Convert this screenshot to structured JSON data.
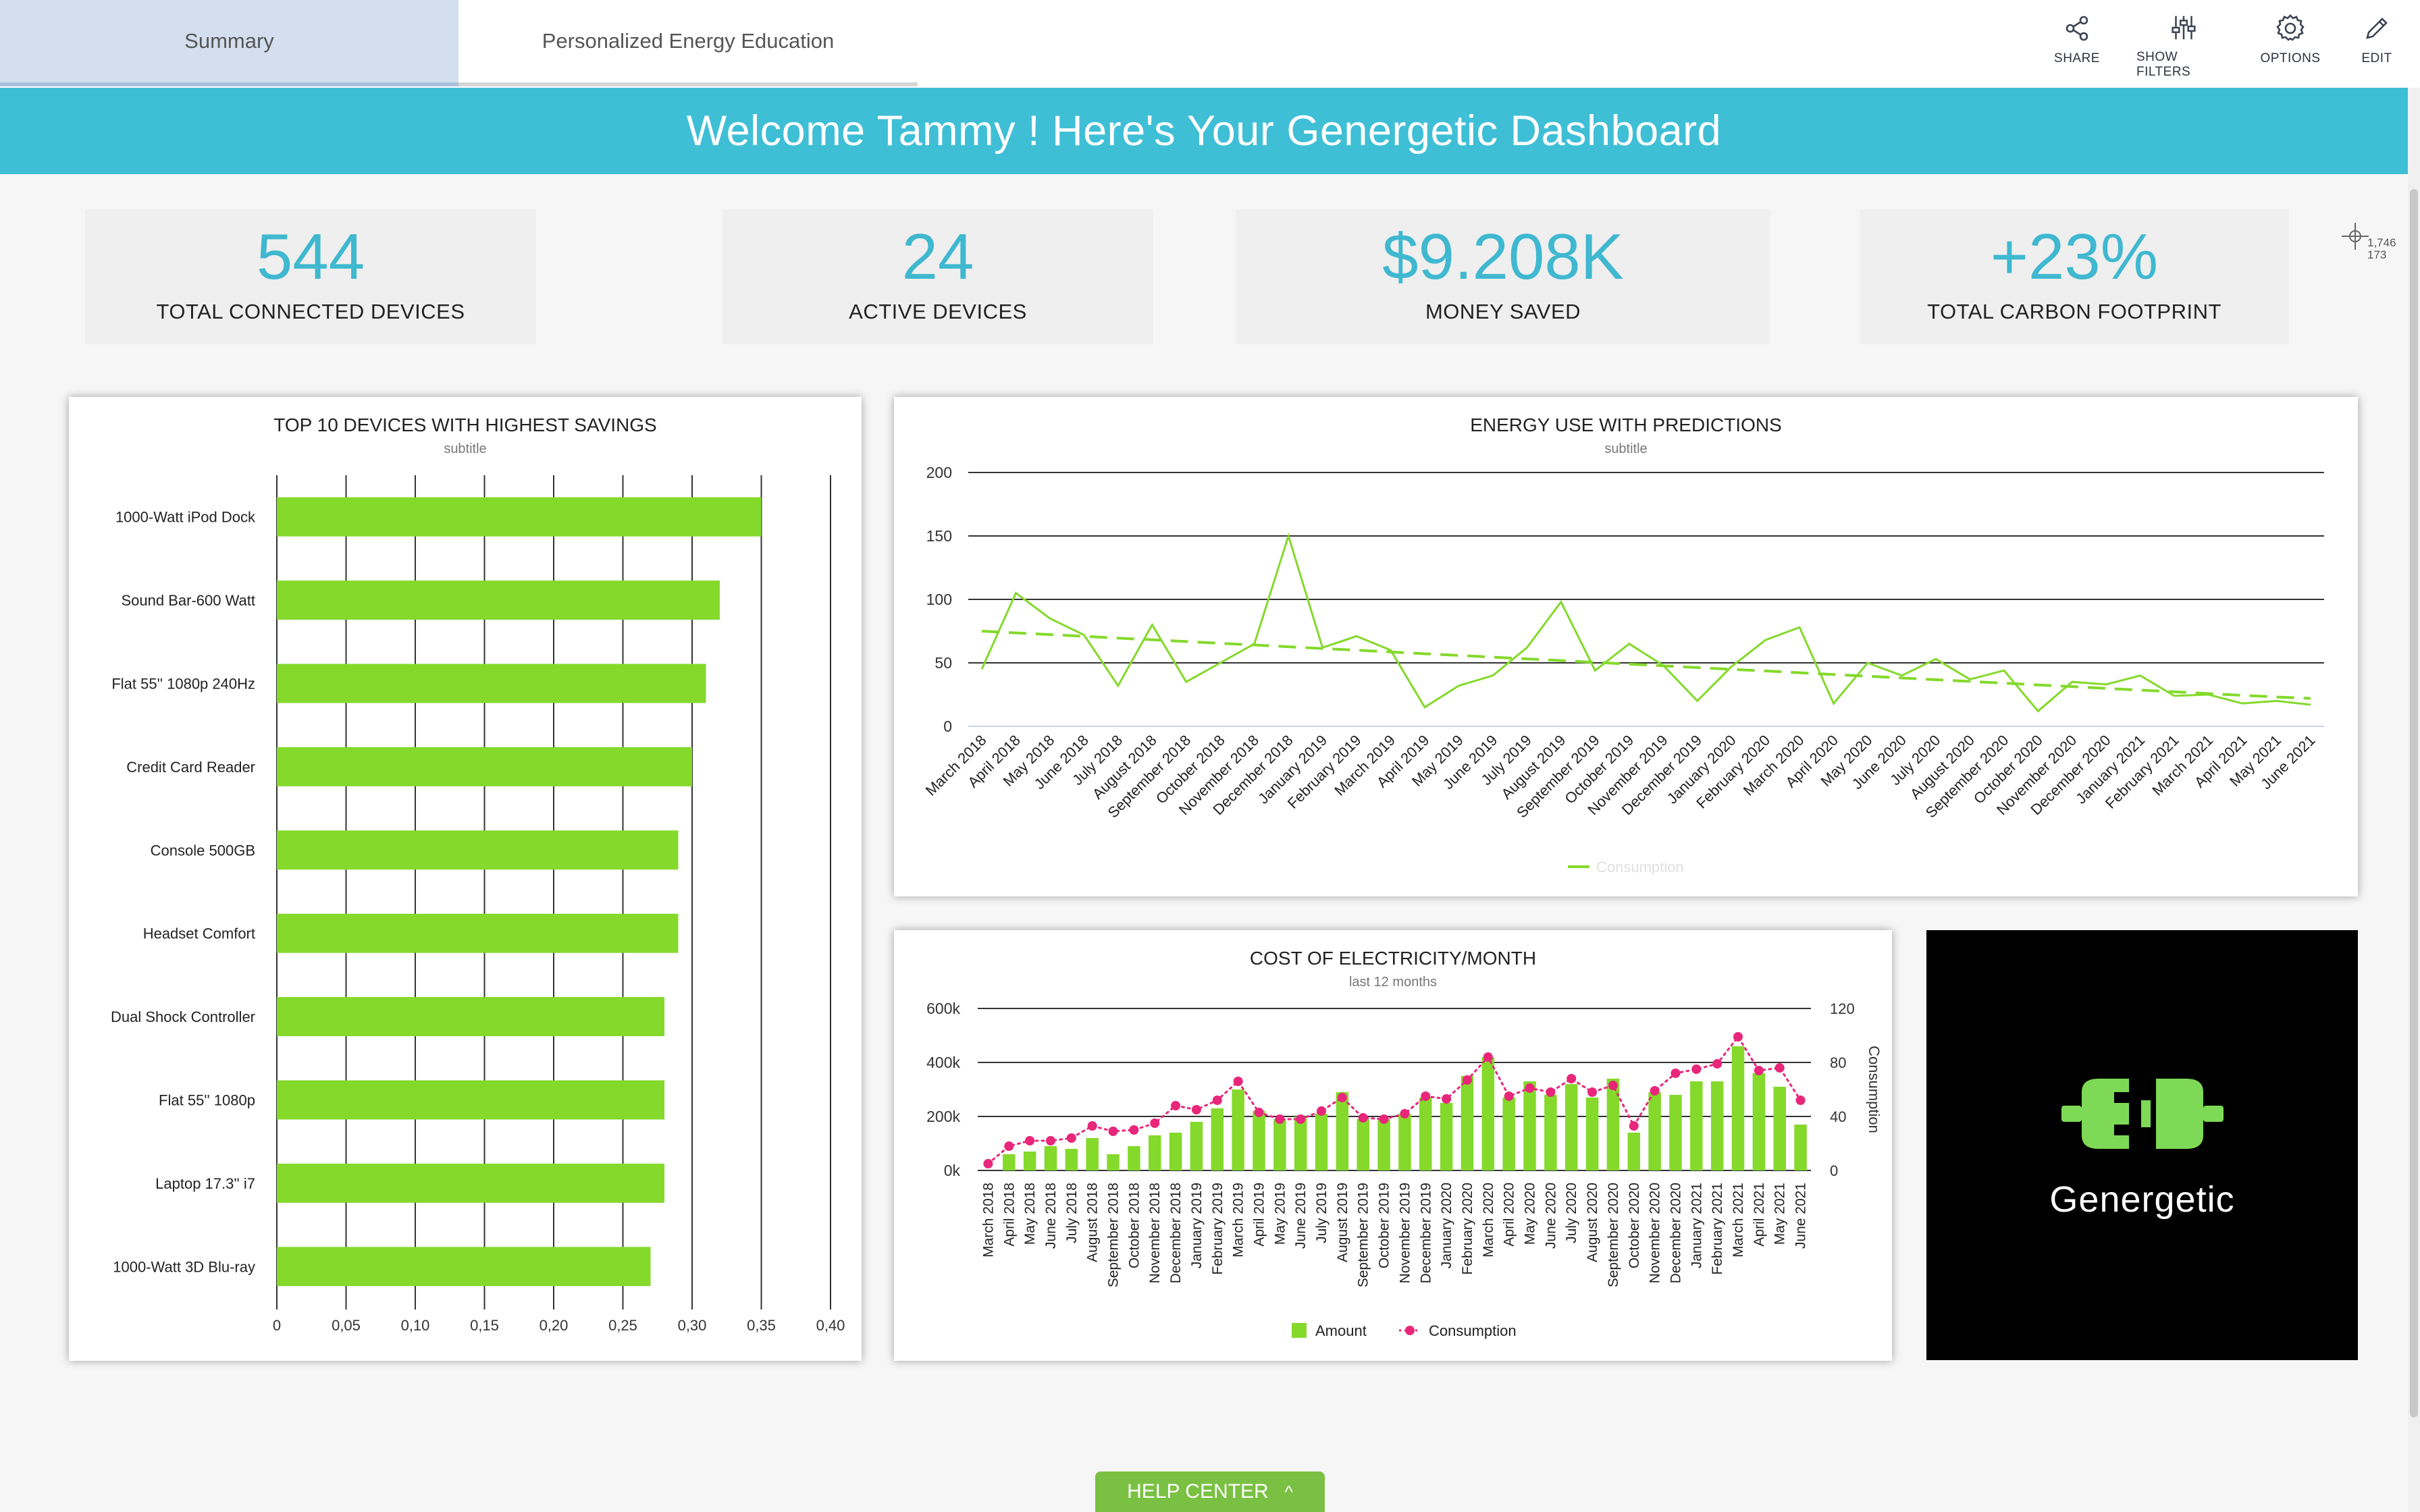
{
  "tabs": [
    {
      "label": "Summary"
    },
    {
      "label": "Personalized Energy Education"
    }
  ],
  "toolbar": {
    "share": "SHARE",
    "show_filters": "SHOW FILTERS",
    "options": "OPTIONS",
    "edit": "EDIT"
  },
  "banner": {
    "text": "Welcome Tammy ! Here's Your Genergetic Dashboard"
  },
  "kpis": [
    {
      "value": "544",
      "label": "TOTAL CONNECTED DEVICES"
    },
    {
      "value": "24",
      "label": "ACTIVE DEVICES"
    },
    {
      "value": "$9.208K",
      "label": "MONEY SAVED"
    },
    {
      "value": "+23%",
      "label": "TOTAL CARBON FOOTPRINT"
    }
  ],
  "cursor_readout": {
    "line1": "1,746",
    "line2": "173"
  },
  "logo": {
    "text": "Genergetic"
  },
  "help_center": {
    "label": "HELP CENTER",
    "chevron": "^"
  },
  "colors": {
    "accent": "#3fbfd6",
    "green": "#7ed321",
    "pink": "#e8267a",
    "logo_green": "#7ed957"
  },
  "chart_data": [
    {
      "type": "bar",
      "orientation": "horizontal",
      "title": "TOP 10 DEVICES WITH HIGHEST SAVINGS",
      "subtitle": "subtitle",
      "categories": [
        "1000-Watt iPod Dock",
        "Sound Bar-600 Watt",
        "Flat 55'' 1080p 240Hz",
        "Credit Card Reader",
        "Console 500GB",
        "Headset Comfort",
        "Dual Shock Controller",
        "Flat 55'' 1080p",
        "Laptop 17.3'' i7",
        "1000-Watt 3D Blu-ray"
      ],
      "values": [
        0.35,
        0.32,
        0.31,
        0.3,
        0.29,
        0.29,
        0.28,
        0.28,
        0.28,
        0.27
      ],
      "xlim": [
        0,
        0.4
      ],
      "xticks": [
        "0",
        "0,05",
        "0,10",
        "0,15",
        "0,20",
        "0,25",
        "0,30",
        "0,35",
        "0,40"
      ],
      "color": "#84d92b",
      "grid": true
    },
    {
      "type": "line",
      "title": "ENERGY USE WITH PREDICTIONS",
      "subtitle": "subtitle",
      "categories": [
        "March 2018",
        "April 2018",
        "May 2018",
        "June 2018",
        "July 2018",
        "August 2018",
        "September 2018",
        "October 2018",
        "November 2018",
        "December 2018",
        "January 2019",
        "February 2019",
        "March 2019",
        "April 2019",
        "May 2019",
        "June 2019",
        "July 2019",
        "August 2019",
        "September 2019",
        "October 2019",
        "November 2019",
        "December 2019",
        "January 2020",
        "February 2020",
        "March 2020",
        "April 2020",
        "May 2020",
        "June 2020",
        "July 2020",
        "August 2020",
        "September 2020",
        "October 2020",
        "November 2020",
        "December 2020",
        "January 2021",
        "February 2021",
        "March 2021",
        "April 2021",
        "May 2021",
        "June 2021"
      ],
      "series": [
        {
          "name": "Consumption",
          "values": [
            45,
            105,
            85,
            72,
            32,
            80,
            35,
            50,
            65,
            150,
            62,
            71,
            60,
            15,
            32,
            40,
            62,
            98,
            44,
            65,
            48,
            20,
            47,
            68,
            78,
            18,
            50,
            40,
            53,
            37,
            44,
            12,
            35,
            33,
            40,
            24,
            25,
            18,
            20,
            17
          ],
          "style": "solid"
        },
        {
          "name": "",
          "values": [
            75,
            73.6,
            72.3,
            70.9,
            69.5,
            68.2,
            66.8,
            65.4,
            64.1,
            62.7,
            61.3,
            60.0,
            58.6,
            57.2,
            55.9,
            54.5,
            53.1,
            51.8,
            50.4,
            49.0,
            47.7,
            46.3,
            44.9,
            43.6,
            42.2,
            40.8,
            39.5,
            38.1,
            36.7,
            35.4,
            34.0,
            32.6,
            31.3,
            29.9,
            28.5,
            27.2,
            25.8,
            24.4,
            23.1,
            22
          ],
          "style": "dashed"
        }
      ],
      "yticks": [
        "0",
        "50",
        "100",
        "150",
        "200"
      ],
      "ylim": [
        0,
        200
      ],
      "legend": "bottom-center",
      "color": "#84d92b",
      "grid": true
    },
    {
      "type": "bar",
      "title": "COST OF ELECTRICITY/MONTH",
      "subtitle": "last 12 months",
      "categories": [
        "March 2018",
        "April 2018",
        "May 2018",
        "June 2018",
        "July 2018",
        "August 2018",
        "September 2018",
        "October 2018",
        "November 2018",
        "December 2018",
        "January 2019",
        "February 2019",
        "March 2019",
        "April 2019",
        "May 2019",
        "June 2019",
        "July 2019",
        "August 2019",
        "September 2019",
        "October 2019",
        "November 2019",
        "December 2019",
        "January 2020",
        "February 2020",
        "March 2020",
        "April 2020",
        "May 2020",
        "June 2020",
        "July 2020",
        "August 2020",
        "September 2020",
        "October 2020",
        "November 2020",
        "December 2020",
        "January 2021",
        "February 2021",
        "March 2021",
        "April 2021",
        "May 2021",
        "June 2021"
      ],
      "series": [
        {
          "name": "Amount",
          "axis": "left",
          "kind": "bar",
          "values": [
            0,
            60000,
            70000,
            90000,
            80000,
            120000,
            60000,
            90000,
            130000,
            140000,
            180000,
            230000,
            300000,
            220000,
            190000,
            200000,
            210000,
            290000,
            190000,
            190000,
            210000,
            270000,
            250000,
            350000,
            420000,
            270000,
            330000,
            280000,
            320000,
            270000,
            340000,
            140000,
            290000,
            280000,
            330000,
            330000,
            460000,
            360000,
            310000,
            170000
          ]
        },
        {
          "name": "Consumption",
          "axis": "right",
          "kind": "line-dotted",
          "values": [
            5,
            18,
            22,
            22,
            24,
            33,
            29,
            30,
            35,
            48,
            45,
            52,
            66,
            43,
            38,
            38,
            44,
            54,
            39,
            38,
            42,
            55,
            53,
            67,
            84,
            55,
            61,
            58,
            68,
            58,
            63,
            33,
            59,
            72,
            75,
            79,
            99,
            74,
            76,
            52
          ]
        }
      ],
      "yticks_left": [
        "0k",
        "200k",
        "400k",
        "600k"
      ],
      "ylim_left": [
        0,
        600000
      ],
      "yticks_right": [
        "0",
        "40",
        "80",
        "120"
      ],
      "ylim_right": [
        0,
        120
      ],
      "ylabel_right": "Consumption",
      "legend": "bottom-center",
      "colors": {
        "Amount": "#84d92b",
        "Consumption": "#e8267a"
      },
      "grid": true
    }
  ]
}
